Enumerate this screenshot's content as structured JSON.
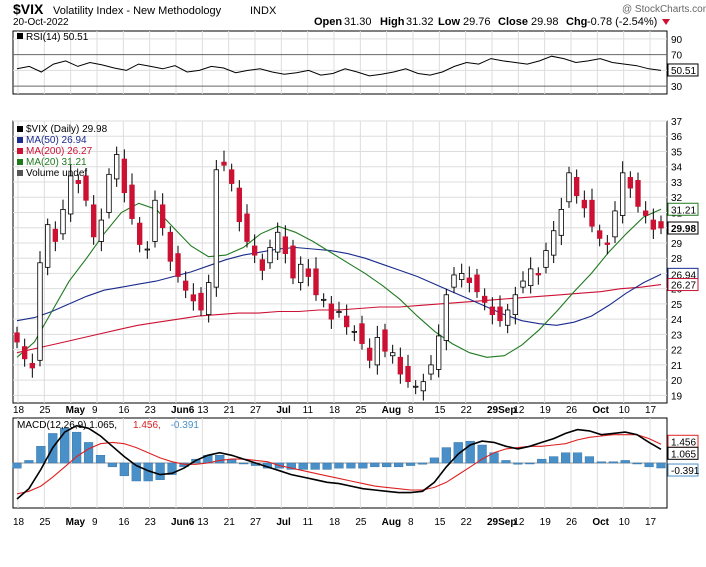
{
  "header": {
    "symbol": "$VIX",
    "name": "Volatility Index - New Methodology",
    "exchange": "INDX",
    "date": "20-Oct-2022",
    "open_label": "Open",
    "open": "31.30",
    "high_label": "High",
    "high": "31.32",
    "low_label": "Low",
    "low": "29.76",
    "close_label": "Close",
    "close": "29.98",
    "chg_label": "Chg",
    "chg": "-0.78 (-2.54%)",
    "watermark": "@ StockCharts.com"
  },
  "colors": {
    "up": "#ffffff",
    "down": "#cc1133",
    "ma50": "#1a2b8c",
    "ma200": "#cc1133",
    "ma20": "#1f7a1f",
    "macd_hist": "#4a90c8",
    "macd_line": "#000000",
    "signal_line": "#dd2222"
  },
  "chart_data": [
    {
      "type": "line",
      "title": "RSI(14) 50.51",
      "legend": "RSI(14) 50.51",
      "ylim": [
        20,
        100
      ],
      "ticks": [
        "90",
        "70",
        "50",
        "30"
      ],
      "last_value": "50.51",
      "series": [
        {
          "values": [
            52,
            55,
            48,
            58,
            62,
            55,
            60,
            57,
            53,
            50,
            58,
            55,
            52,
            56,
            48,
            50,
            55,
            53,
            47,
            50,
            52,
            48,
            45,
            47,
            50,
            44,
            46,
            52,
            48,
            43,
            45,
            48,
            52,
            46,
            44,
            48,
            55,
            60,
            58,
            65,
            62,
            60,
            58,
            62,
            68,
            65,
            60,
            62,
            65,
            60,
            58,
            56,
            52,
            50
          ]
        }
      ]
    },
    {
      "type": "candlestick",
      "title": "$VIX (Daily) 29.98",
      "legend": [
        {
          "label": "$VIX (Daily) 29.98",
          "color": "#000000"
        },
        {
          "label": "MA(50) 26.94",
          "color": "#1a2b8c"
        },
        {
          "label": "MA(200) 26.27",
          "color": "#cc1133"
        },
        {
          "label": "MA(20) 31.21",
          "color": "#1f7a1f"
        },
        {
          "label": "Volume undef",
          "color": "#555555"
        }
      ],
      "ylim": [
        18.5,
        37
      ],
      "y_ticks": [
        19,
        20,
        21,
        22,
        23,
        24,
        25,
        26,
        27,
        28,
        29,
        30,
        31,
        32,
        33,
        34,
        35,
        36,
        37
      ],
      "x_labels": [
        "18",
        "25",
        "May",
        "9",
        "16",
        "23",
        "Jun6",
        "13",
        "21",
        "27",
        "Jul",
        "11",
        "18",
        "25",
        "Aug",
        "8",
        "15",
        "22",
        "29Sep",
        "12",
        "19",
        "26",
        "Oct",
        "10",
        "17"
      ],
      "price_tags": [
        {
          "label": "31.21",
          "value": 31.21,
          "style": "green"
        },
        {
          "label": "29.98",
          "value": 29.98,
          "style": "bold"
        },
        {
          "label": "26.94",
          "value": 26.94,
          "style": "blue"
        },
        {
          "label": "26.27",
          "value": 26.27,
          "style": "red"
        }
      ],
      "close": [
        22.5,
        21.4,
        20.8,
        27.7,
        30.2,
        29.1,
        31.2,
        33.4,
        32.9,
        31.8,
        29.4,
        30.5,
        33.5,
        34.8,
        32.3,
        30.6,
        28.9,
        28.6,
        31.8,
        30.0,
        27.8,
        26.8,
        25.9,
        25.2,
        24.6,
        26.4,
        33.8,
        34.1,
        32.9,
        30.4,
        29.1,
        28.2,
        27.2,
        28.7,
        29.7,
        28.3,
        26.7,
        27.6,
        26.8,
        25.6,
        25.3,
        24.0,
        24.5,
        23.5,
        23.2,
        22.4,
        21.3,
        22.8,
        21.9,
        21.8,
        20.4,
        19.9,
        19.6,
        19.9,
        21.0,
        22.9,
        25.6,
        26.9,
        27.0,
        26.4,
        25.8,
        25.1,
        24.3,
        23.9,
        24.6,
        25.6,
        26.5,
        27.3,
        26.9,
        28.5,
        29.8,
        31.2,
        33.6,
        32.1,
        31.3,
        30.1,
        29.3,
        28.9,
        31.1,
        33.6,
        32.6,
        31.4,
        30.8,
        29.9,
        29.98
      ],
      "ma50": [
        23.9,
        24.1,
        24.5,
        25.0,
        25.5,
        25.9,
        26.1,
        26.3,
        26.5,
        26.8,
        27.1,
        27.5,
        27.9,
        28.2,
        28.4,
        28.6,
        28.7,
        28.6,
        28.5,
        28.3,
        28.0,
        27.6,
        27.2,
        26.8,
        26.3,
        25.8,
        25.3,
        24.8,
        24.3,
        23.9,
        23.7,
        23.6,
        23.8,
        24.2,
        24.9,
        25.7,
        26.4,
        26.94
      ],
      "ma200": [
        21.8,
        22.1,
        22.4,
        22.7,
        23.0,
        23.3,
        23.6,
        23.8,
        24.0,
        24.2,
        24.3,
        24.4,
        24.4,
        24.5,
        24.5,
        24.6,
        24.6,
        24.7,
        24.8,
        24.8,
        24.9,
        25.0,
        25.1,
        25.2,
        25.3,
        25.4,
        25.5,
        25.6,
        25.7,
        25.8,
        26.0,
        26.1,
        26.27
      ],
      "ma20": [
        21.5,
        22.5,
        24.5,
        26.5,
        28.0,
        29.6,
        31.0,
        31.6,
        31.2,
        30.0,
        28.8,
        28.1,
        28.2,
        28.7,
        29.6,
        30.1,
        29.7,
        29.1,
        28.4,
        27.7,
        27.0,
        26.2,
        25.3,
        24.2,
        23.2,
        22.4,
        21.8,
        21.5,
        21.6,
        22.3,
        23.3,
        24.5,
        25.8,
        27.0,
        28.4,
        29.6,
        30.7,
        31.21
      ]
    },
    {
      "type": "line",
      "title": "MACD(12,26,9) 1.065, 1.456, -0.391",
      "legend": [
        {
          "label": "MACD(12,26,9) 1.065,",
          "color": "#000000"
        },
        {
          "label": "1.456,",
          "color": "#dd2222"
        },
        {
          "label": "-0.391",
          "color": "#4a90c8"
        }
      ],
      "tags": [
        "1.456",
        "1.065",
        "-0.391"
      ],
      "macd": [
        -2.8,
        -2.0,
        -0.5,
        1.2,
        2.4,
        2.9,
        2.7,
        2.1,
        1.3,
        0.5,
        -0.2,
        -0.6,
        -0.9,
        -0.8,
        -0.4,
        0.2,
        0.6,
        0.8,
        0.6,
        0.3,
        0.0,
        -0.3,
        -0.6,
        -0.9,
        -1.1,
        -1.3,
        -1.5,
        -1.6,
        -1.8,
        -2.0,
        -2.1,
        -2.2,
        -2.3,
        -2.3,
        -2.2,
        -1.5,
        -0.3,
        0.7,
        1.4,
        1.7,
        1.6,
        1.3,
        1.1,
        1.3,
        1.6,
        1.9,
        2.3,
        2.6,
        2.5,
        2.2,
        2.3,
        2.4,
        2.2,
        1.6,
        1.065
      ],
      "signal": [
        -2.4,
        -2.2,
        -1.8,
        -1.1,
        -0.3,
        0.5,
        1.1,
        1.5,
        1.6,
        1.5,
        1.2,
        0.8,
        0.4,
        0.1,
        -0.1,
        -0.1,
        0.0,
        0.2,
        0.3,
        0.3,
        0.2,
        0.1,
        -0.2,
        -0.4,
        -0.6,
        -0.8,
        -1.0,
        -1.2,
        -1.4,
        -1.6,
        -1.8,
        -1.9,
        -2.0,
        -2.1,
        -2.1,
        -1.9,
        -1.5,
        -0.9,
        -0.3,
        0.3,
        0.8,
        1.1,
        1.2,
        1.3,
        1.3,
        1.4,
        1.5,
        1.8,
        2.0,
        2.1,
        2.2,
        2.2,
        2.2,
        1.9,
        1.456
      ],
      "hist": [
        -0.4,
        0.2,
        1.3,
        2.3,
        2.7,
        2.4,
        1.6,
        0.6,
        -0.3,
        -1.0,
        -1.4,
        -1.4,
        -1.3,
        -0.9,
        -0.3,
        0.3,
        0.6,
        0.6,
        0.3,
        0.0,
        -0.2,
        -0.4,
        -0.4,
        -0.5,
        -0.5,
        -0.5,
        -0.5,
        -0.4,
        -0.4,
        -0.4,
        -0.3,
        -0.3,
        -0.3,
        -0.2,
        -0.1,
        0.4,
        1.2,
        1.6,
        1.7,
        1.4,
        0.8,
        0.2,
        -0.1,
        0.0,
        0.3,
        0.5,
        0.8,
        0.8,
        0.5,
        0.1,
        0.1,
        0.2,
        0.0,
        -0.3,
        -0.391
      ]
    }
  ]
}
